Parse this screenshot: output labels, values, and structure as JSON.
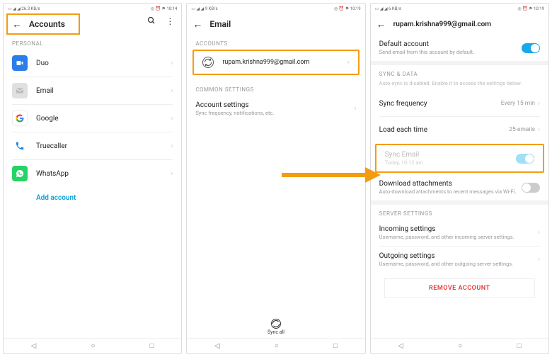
{
  "colors": {
    "highlight": "#f39c12",
    "link": "#0aa0d8",
    "danger": "#e53935",
    "toggle_on": "#1aa9e8"
  },
  "screen1": {
    "status": {
      "left": "▭ ◢ ◢ 26.3 KB/s",
      "right": "◎ ⏰ ⚑ 10:14"
    },
    "title": "Accounts",
    "section_personal": "PERSONAL",
    "items": [
      {
        "name": "Duo",
        "icon_color": "#2b7de9"
      },
      {
        "name": "Email",
        "icon_color": "#e0e0e0"
      },
      {
        "name": "Google",
        "icon_color": "#fff"
      },
      {
        "name": "Truecaller",
        "icon_color": "#1976d2"
      },
      {
        "name": "WhatsApp",
        "icon_color": "#25D366"
      }
    ],
    "add_account": "Add account"
  },
  "screen2": {
    "status": {
      "left": "▭ ◢ ◢ 9 KB/s",
      "right": "◎ ⏰ ⚑ 10:19"
    },
    "title": "Email",
    "section_accounts": "ACCOUNTS",
    "account_email": "rupam.krishna999@gmail.com",
    "section_common": "COMMON SETTINGS",
    "account_settings": {
      "label": "Account settings",
      "sub": "Sync frequency, notifications, etc."
    },
    "sync_all": "Sync all"
  },
  "screen3": {
    "status": {
      "left": "▭ ◢ ◢ 6 KB/s",
      "right": "◎ ⏰ ⚑ 10:19"
    },
    "title": "rupam.krishna999@gmail.com",
    "default_account": {
      "label": "Default account",
      "sub": "Send email from this account by default."
    },
    "section_sync": "SYNC & DATA",
    "autosync_note": "Auto-sync is disabled. Enable it to access the settings below.",
    "sync_frequency": {
      "label": "Sync frequency",
      "value": "Every 15 min"
    },
    "load_each": {
      "label": "Load each time",
      "value": "25 emails"
    },
    "sync_email": {
      "label": "Sync Email",
      "sub": "Today, 10:12 am"
    },
    "download_attach": {
      "label": "Download attachments",
      "sub": "Auto-download attachments to recent messages via Wi-Fi."
    },
    "section_server": "SERVER SETTINGS",
    "incoming": {
      "label": "Incoming settings",
      "sub": "Username, password, and other incoming server settings."
    },
    "outgoing": {
      "label": "Outgoing settings",
      "sub": "Username, password, and other outgoing server settings."
    },
    "remove": "REMOVE ACCOUNT"
  }
}
